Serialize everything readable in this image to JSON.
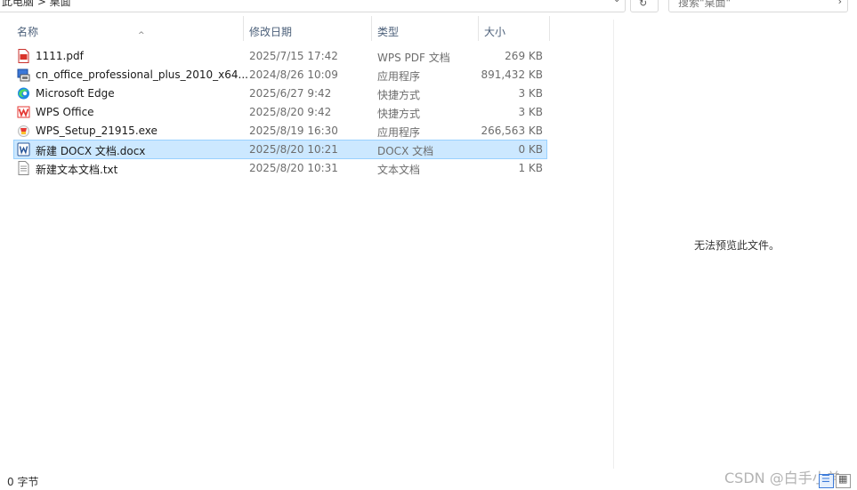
{
  "address": {
    "path": "此电脑 > 桌面"
  },
  "search": {
    "placeholder": "搜索\"桌面\""
  },
  "columns": {
    "name": "名称",
    "date": "修改日期",
    "type": "类型",
    "size": "大小"
  },
  "files": [
    {
      "icon": "pdf-file-icon",
      "name": "1111.pdf",
      "date": "2025/7/15 17:42",
      "type": "WPS PDF 文档",
      "size": "269 KB",
      "selected": false
    },
    {
      "icon": "installer-icon",
      "name": "cn_office_professional_plus_2010_x64...",
      "date": "2024/8/26 10:09",
      "type": "应用程序",
      "size": "891,432 KB",
      "selected": false
    },
    {
      "icon": "edge-icon",
      "name": "Microsoft Edge",
      "date": "2025/6/27 9:42",
      "type": "快捷方式",
      "size": "3 KB",
      "selected": false
    },
    {
      "icon": "wps-office-icon",
      "name": "WPS Office",
      "date": "2025/8/20 9:42",
      "type": "快捷方式",
      "size": "3 KB",
      "selected": false
    },
    {
      "icon": "wps-setup-icon",
      "name": "WPS_Setup_21915.exe",
      "date": "2025/8/19 16:30",
      "type": "应用程序",
      "size": "266,563 KB",
      "selected": false
    },
    {
      "icon": "word-docx-icon",
      "name": "新建 DOCX 文档.docx",
      "date": "2025/8/20 10:21",
      "type": "DOCX 文档",
      "size": "0 KB",
      "selected": true
    },
    {
      "icon": "text-file-icon",
      "name": "新建文本文档.txt",
      "date": "2025/8/20 10:31",
      "type": "文本文档",
      "size": "1 KB",
      "selected": false
    }
  ],
  "preview": {
    "message": "无法预览此文件。"
  },
  "status": {
    "count": "0 字节"
  },
  "watermark": "CSDN @白手小弟",
  "colors": {
    "selection": "#cce8ff",
    "selection_border": "#99d1ff",
    "header_text": "#4c607a"
  }
}
